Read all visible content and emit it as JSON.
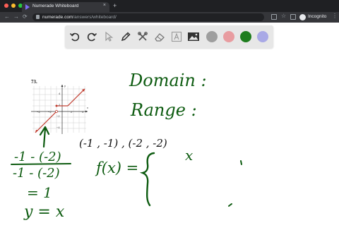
{
  "browser": {
    "tab_title": "Numerade Whiteboard",
    "tab_close": "×",
    "new_tab": "+",
    "url_host": "numerade.com",
    "url_path": "/answers/whiteboard/",
    "profile_label": "Incognito",
    "traffic_lights": [
      "#ff5f57",
      "#febc2e",
      "#28c840"
    ]
  },
  "toolbar": {
    "tools": [
      "undo-icon",
      "redo-icon",
      "select-icon",
      "pen-icon",
      "tools-icon",
      "eraser-icon",
      "text-icon",
      "image-icon"
    ],
    "colors": [
      "#9e9e9e",
      "#e89ca0",
      "#1e7d1e",
      "#a9a9e6"
    ],
    "selected_color": "#1e7d1e"
  },
  "problem": {
    "number": "73.",
    "x_ticks": [
      "−4",
      "−2",
      "2",
      "4"
    ],
    "y_ticks": [
      "4",
      "2",
      "−2",
      "−4"
    ],
    "axis_x": "x",
    "axis_y": "y"
  },
  "handwriting": {
    "domain": "Domain :",
    "range": "Range :",
    "points": "(-1 , -1) , (-2 , -2)",
    "fraction_numerator": "-1 - (-2)",
    "fraction_denominator": "-1 - (-2)",
    "equals_one": "= 1",
    "y_equals_x": "y = x",
    "f_of_x": "f(x) =",
    "case_x": "x"
  }
}
